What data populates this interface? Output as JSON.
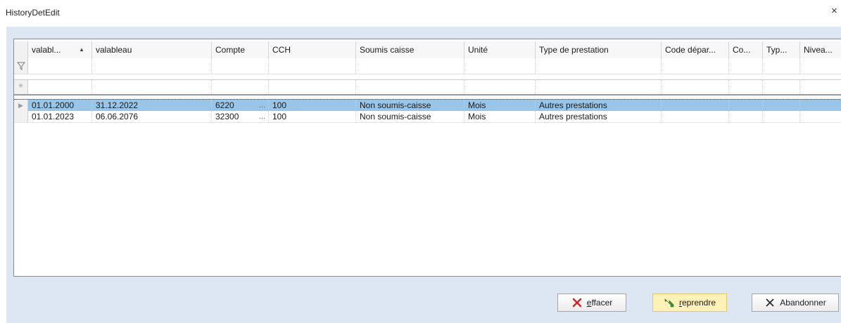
{
  "window": {
    "title": "HistoryDetEdit",
    "close_glyph": "×"
  },
  "grid": {
    "columns": [
      {
        "label": "valabl...",
        "sorted": "ascending"
      },
      {
        "label": "valableau"
      },
      {
        "label": "Compte"
      },
      {
        "label": "CCH"
      },
      {
        "label": "Soumis caisse"
      },
      {
        "label": "Unité"
      },
      {
        "label": "Type de prestation"
      },
      {
        "label": "Code dépar..."
      },
      {
        "label": "Co..."
      },
      {
        "label": "Typ..."
      },
      {
        "label": "Nivea..."
      }
    ],
    "rows": [
      {
        "selected": true,
        "cells": [
          "01.01.2000",
          "31.12.2022",
          "6220",
          "100",
          "Non soumis-caisse",
          "Mois",
          "Autres prestations",
          "",
          "",
          "",
          ""
        ]
      },
      {
        "selected": false,
        "cells": [
          "01.01.2023",
          "06.06.2076",
          "32300",
          "100",
          "Non soumis-caisse",
          "Mois",
          "Autres prestations",
          "",
          "",
          "",
          ""
        ]
      }
    ],
    "ellipsis": "...",
    "filter_icon": "funnel-icon",
    "new_row_glyph": "✳",
    "current_row_glyph": "▶",
    "sort_glyph": "▲"
  },
  "buttons": {
    "effacer": {
      "accel": "e",
      "rest": "ffacer",
      "icon": "red-x-icon",
      "color": "#d32020"
    },
    "reprendre": {
      "accel": "r",
      "rest": "eprendre",
      "icon": "green-arrow-icon",
      "color": "#2e9a3a"
    },
    "abandonner": {
      "label": "Abandonner",
      "icon": "black-x-icon"
    }
  },
  "colors": {
    "selection": "#99c5e8",
    "client_bg": "#dde7f3",
    "default_button": "#fff1b8"
  }
}
